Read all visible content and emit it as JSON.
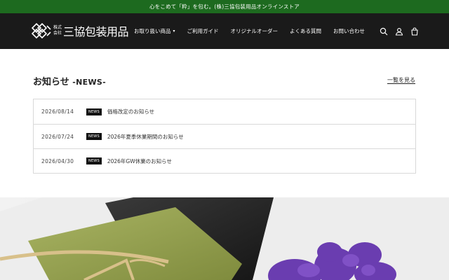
{
  "announcement": "心をこめて「粋」を包む。(株)三協包装用品オンラインストア",
  "brand": {
    "company_prefix_1": "株式",
    "company_prefix_2": "会社",
    "name": "三協包装用品"
  },
  "nav": [
    {
      "label": "お取り扱い商品",
      "has_dropdown": true
    },
    {
      "label": "ご利用ガイド",
      "has_dropdown": false
    },
    {
      "label": "オリジナルオーダー",
      "has_dropdown": false
    },
    {
      "label": "よくある質問",
      "has_dropdown": false
    },
    {
      "label": "お問い合わせ",
      "has_dropdown": false
    }
  ],
  "header_icons": [
    "search-icon",
    "account-icon",
    "cart-icon"
  ],
  "news": {
    "title_jp": "お知らせ",
    "title_en": "-NEWS-",
    "see_all": "一覧を見る",
    "items": [
      {
        "date": "2026/08/14",
        "badge": "NEWS",
        "text": "価格改定のお知らせ"
      },
      {
        "date": "2026/07/24",
        "badge": "NEWS",
        "text": "2026年夏季休業期間のお知らせ"
      },
      {
        "date": "2026/04/30",
        "badge": "NEWS",
        "text": "2026年GW休業のお知らせ"
      }
    ]
  },
  "colors": {
    "announcement_bg": "#1d6a1f",
    "header_bg": "#1a1a1a",
    "badge_bg": "#111111"
  }
}
